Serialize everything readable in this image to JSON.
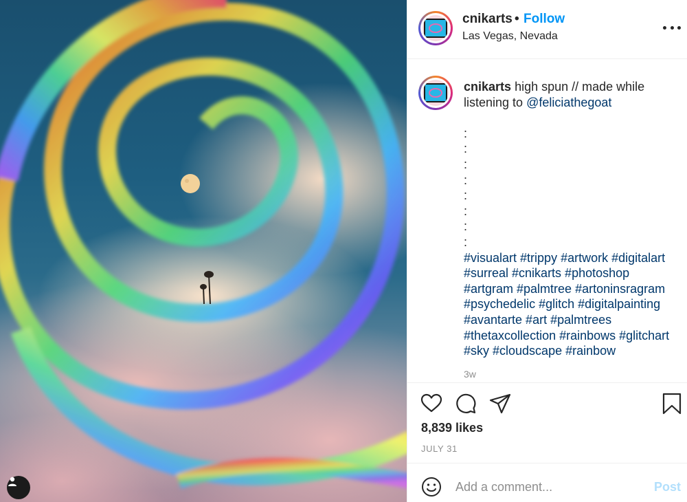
{
  "post": {
    "username": "cnikarts",
    "separator": "•",
    "follow_label": "Follow",
    "location": "Las Vegas, Nevada",
    "caption": {
      "username": "cnikarts",
      "text": "high spun // made while listening to",
      "mention": "@feliciathegoat",
      "dots": ":\n:\n:\n:\n:\n:\n:\n:",
      "hashtags": "#visualart #trippy #artwork #digitalart #surreal #cnikarts #photoshop #artgram #palmtree #artoninsragram #psychedelic #glitch #digitalpainting #avantarte #art #palmtrees #thetaxcollection #rainbows #glitchart #sky #cloudscape #rainbow"
    },
    "time_ago": "3w",
    "likes": "8,839 likes",
    "date": "JULY 31"
  },
  "comment_box": {
    "placeholder": "Add a comment...",
    "post_label": "Post"
  },
  "icons": {
    "avatar": "avatar-icon",
    "more": "more-options-icon",
    "like": "heart-icon",
    "comment": "comment-icon",
    "share": "paper-plane-icon",
    "save": "bookmark-icon",
    "emoji": "smiley-icon",
    "user": "user-icon"
  },
  "colors": {
    "accent": "#0095f6",
    "link": "#00376b",
    "post_disabled": "#b2dffc",
    "muted": "#8e8e8e"
  }
}
